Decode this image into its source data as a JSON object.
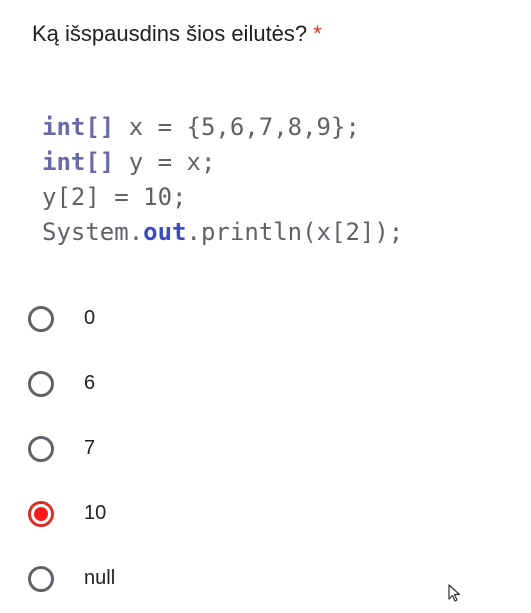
{
  "question": {
    "text": "Ką išspausdins šios eilutės?",
    "required_mark": "*"
  },
  "code": {
    "line1": {
      "kw": "int[]",
      "rest": " x = {5,6,7,8,9};"
    },
    "line2": {
      "kw": "int[]",
      "rest": " y = x;"
    },
    "line3": "y[2] = 10;",
    "line4": {
      "pre": "System.",
      "field": "out",
      "post": ".println(x[2]);"
    }
  },
  "options": [
    {
      "label": "0",
      "selected": false
    },
    {
      "label": "6",
      "selected": false
    },
    {
      "label": "7",
      "selected": false
    },
    {
      "label": "10",
      "selected": true
    },
    {
      "label": "null",
      "selected": false
    }
  ],
  "colors": {
    "required": "#d93025",
    "selected_radio": "#ff1a1a",
    "keyword": "#6b6aa8",
    "field": "#3b4cc0"
  },
  "icons": {
    "cursor": "mouse-pointer-icon"
  }
}
